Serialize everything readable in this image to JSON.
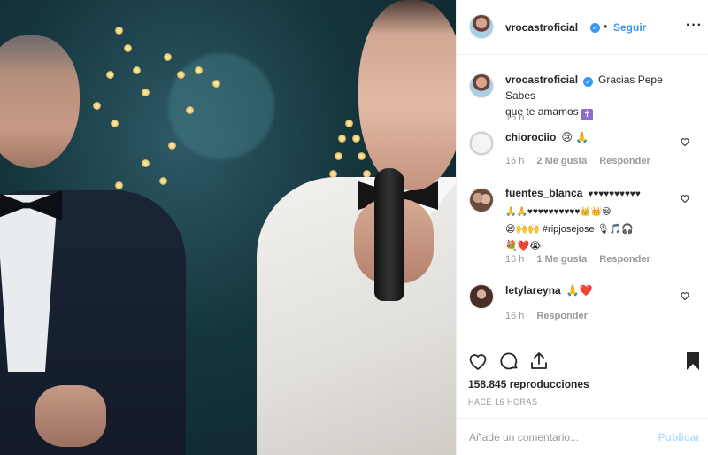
{
  "header": {
    "username": "vrocastroficial",
    "separator": "•",
    "follow_label": "Seguir",
    "more_icon": "more-horizontal-icon"
  },
  "caption": {
    "username": "vrocastroficial",
    "text": "Gracias Pepe Sabes que te amamos ✝️",
    "line1": "Gracias Pepe Sabes",
    "line2": "que te amamos",
    "time": "16 h"
  },
  "comments": [
    {
      "username": "chiorociio",
      "text": "😢 🙏",
      "time": "16 h",
      "likes": "2 Me gusta",
      "reply": "Responder"
    },
    {
      "username": "fuentes_blanca",
      "line1": "♥♥♥♥♥♥♥♥♥♥",
      "line2": "🙏🙏♥♥♥♥♥♥♥♥♥♥👑👑😪",
      "line3": "😪🙌🙌 #ripjosejose 🎙🎵🎧",
      "line4": "💐❤️😭",
      "time": "16 h",
      "likes": "1 Me gusta",
      "reply": "Responder"
    },
    {
      "username": "letylareyna",
      "text": "🙏❤️",
      "time": "16 h",
      "reply": "Responder"
    }
  ],
  "actions": {
    "icons": [
      "heart-icon",
      "comment-icon",
      "share-icon",
      "bookmark-icon"
    ],
    "views": "158.845 reproducciones",
    "posted": "HACE 16 HORAS"
  },
  "add_comment": {
    "placeholder": "Añade un comentario...",
    "publish_label": "Publicar"
  },
  "colors": {
    "accent": "#3897f0",
    "text": "#262626",
    "muted": "#999999",
    "publish_disabled": "#b2dffc",
    "border": "#efefef"
  }
}
